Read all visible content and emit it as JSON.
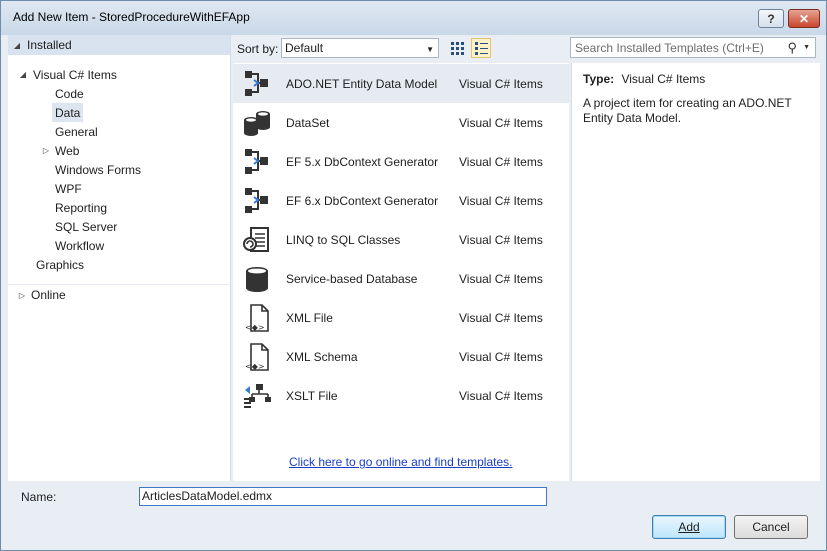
{
  "window": {
    "title": "Add New Item - StoredProcedureWithEFApp",
    "help_label": "?",
    "close_label": "✕"
  },
  "sidebar": {
    "installed": "Installed",
    "online": "Online",
    "tree": [
      {
        "label": "Visual C# Items"
      },
      {
        "label": "Code"
      },
      {
        "label": "Data"
      },
      {
        "label": "General"
      },
      {
        "label": "Web"
      },
      {
        "label": "Windows Forms"
      },
      {
        "label": "WPF"
      },
      {
        "label": "Reporting"
      },
      {
        "label": "SQL Server"
      },
      {
        "label": "Workflow"
      },
      {
        "label": "Graphics"
      }
    ]
  },
  "toolbar": {
    "sort_label": "Sort by:",
    "sort_value": "Default",
    "search_placeholder": "Search Installed Templates (Ctrl+E)"
  },
  "templates": [
    {
      "name": "ADO.NET Entity Data Model",
      "category": "Visual C# Items",
      "icon": "entity-model-icon"
    },
    {
      "name": "DataSet",
      "category": "Visual C# Items",
      "icon": "database-icon"
    },
    {
      "name": "EF 5.x DbContext Generator",
      "category": "Visual C# Items",
      "icon": "entity-model-icon"
    },
    {
      "name": "EF 6.x DbContext Generator",
      "category": "Visual C# Items",
      "icon": "entity-model-icon"
    },
    {
      "name": "LINQ to SQL Classes",
      "category": "Visual C# Items",
      "icon": "linq-icon"
    },
    {
      "name": "Service-based Database",
      "category": "Visual C# Items",
      "icon": "database-icon"
    },
    {
      "name": "XML File",
      "category": "Visual C# Items",
      "icon": "xml-file-icon"
    },
    {
      "name": "XML Schema",
      "category": "Visual C# Items",
      "icon": "xml-file-icon"
    },
    {
      "name": "XSLT File",
      "category": "Visual C# Items",
      "icon": "xslt-file-icon"
    }
  ],
  "online_link": "Click here to go online and find templates.",
  "details": {
    "type_label": "Type:",
    "type_value": "Visual C# Items",
    "description": "A project item for creating an ADO.NET Entity Data Model."
  },
  "footer": {
    "name_label": "Name:",
    "name_value": "ArticlesDataModel.edmx",
    "add_label": "Add",
    "cancel_label": "Cancel"
  }
}
